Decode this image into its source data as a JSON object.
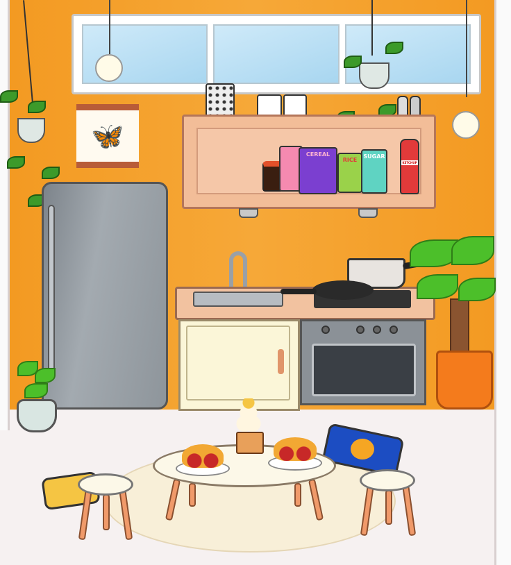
{
  "scene": "kitchen",
  "shelf_items": [
    {
      "label": "CEREAL",
      "color": "#7b3fd0"
    },
    {
      "label": "RICE",
      "color": "#9ad24a"
    },
    {
      "label": "SUGAR",
      "color": "#5fd3c2"
    },
    {
      "label": "KETCHUP",
      "color": "#e23a3a"
    }
  ],
  "colors": {
    "wall": "#f6a838",
    "floor": "#f6f1f1",
    "fridge": "#8e959b",
    "pot": "#f47b1c"
  }
}
